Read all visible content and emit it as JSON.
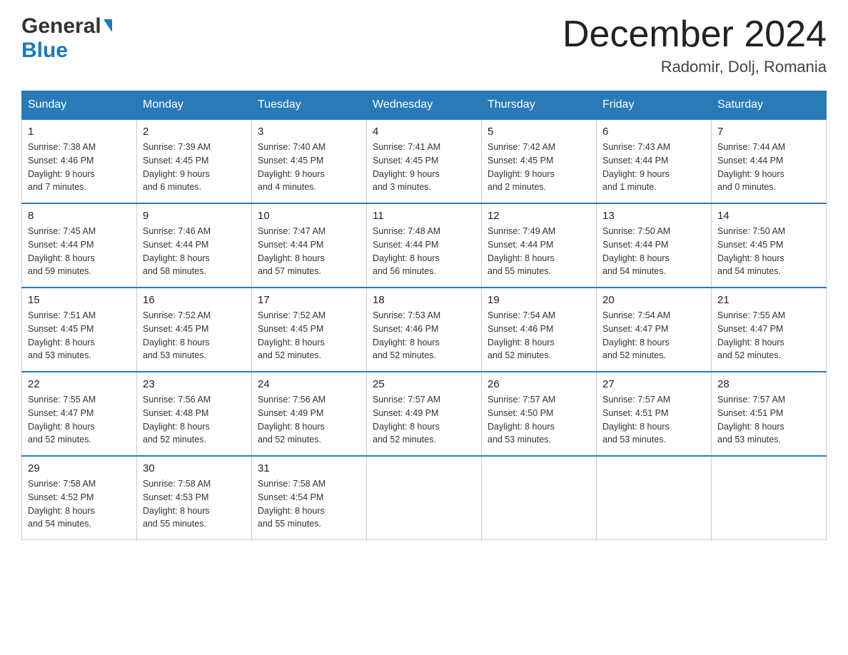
{
  "logo": {
    "general": "General",
    "blue": "Blue"
  },
  "title": "December 2024",
  "location": "Radomir, Dolj, Romania",
  "headers": [
    "Sunday",
    "Monday",
    "Tuesday",
    "Wednesday",
    "Thursday",
    "Friday",
    "Saturday"
  ],
  "weeks": [
    [
      {
        "day": "1",
        "sunrise": "7:38 AM",
        "sunset": "4:46 PM",
        "daylight": "9 hours and 7 minutes."
      },
      {
        "day": "2",
        "sunrise": "7:39 AM",
        "sunset": "4:45 PM",
        "daylight": "9 hours and 6 minutes."
      },
      {
        "day": "3",
        "sunrise": "7:40 AM",
        "sunset": "4:45 PM",
        "daylight": "9 hours and 4 minutes."
      },
      {
        "day": "4",
        "sunrise": "7:41 AM",
        "sunset": "4:45 PM",
        "daylight": "9 hours and 3 minutes."
      },
      {
        "day": "5",
        "sunrise": "7:42 AM",
        "sunset": "4:45 PM",
        "daylight": "9 hours and 2 minutes."
      },
      {
        "day": "6",
        "sunrise": "7:43 AM",
        "sunset": "4:44 PM",
        "daylight": "9 hours and 1 minute."
      },
      {
        "day": "7",
        "sunrise": "7:44 AM",
        "sunset": "4:44 PM",
        "daylight": "9 hours and 0 minutes."
      }
    ],
    [
      {
        "day": "8",
        "sunrise": "7:45 AM",
        "sunset": "4:44 PM",
        "daylight": "8 hours and 59 minutes."
      },
      {
        "day": "9",
        "sunrise": "7:46 AM",
        "sunset": "4:44 PM",
        "daylight": "8 hours and 58 minutes."
      },
      {
        "day": "10",
        "sunrise": "7:47 AM",
        "sunset": "4:44 PM",
        "daylight": "8 hours and 57 minutes."
      },
      {
        "day": "11",
        "sunrise": "7:48 AM",
        "sunset": "4:44 PM",
        "daylight": "8 hours and 56 minutes."
      },
      {
        "day": "12",
        "sunrise": "7:49 AM",
        "sunset": "4:44 PM",
        "daylight": "8 hours and 55 minutes."
      },
      {
        "day": "13",
        "sunrise": "7:50 AM",
        "sunset": "4:44 PM",
        "daylight": "8 hours and 54 minutes."
      },
      {
        "day": "14",
        "sunrise": "7:50 AM",
        "sunset": "4:45 PM",
        "daylight": "8 hours and 54 minutes."
      }
    ],
    [
      {
        "day": "15",
        "sunrise": "7:51 AM",
        "sunset": "4:45 PM",
        "daylight": "8 hours and 53 minutes."
      },
      {
        "day": "16",
        "sunrise": "7:52 AM",
        "sunset": "4:45 PM",
        "daylight": "8 hours and 53 minutes."
      },
      {
        "day": "17",
        "sunrise": "7:52 AM",
        "sunset": "4:45 PM",
        "daylight": "8 hours and 52 minutes."
      },
      {
        "day": "18",
        "sunrise": "7:53 AM",
        "sunset": "4:46 PM",
        "daylight": "8 hours and 52 minutes."
      },
      {
        "day": "19",
        "sunrise": "7:54 AM",
        "sunset": "4:46 PM",
        "daylight": "8 hours and 52 minutes."
      },
      {
        "day": "20",
        "sunrise": "7:54 AM",
        "sunset": "4:47 PM",
        "daylight": "8 hours and 52 minutes."
      },
      {
        "day": "21",
        "sunrise": "7:55 AM",
        "sunset": "4:47 PM",
        "daylight": "8 hours and 52 minutes."
      }
    ],
    [
      {
        "day": "22",
        "sunrise": "7:55 AM",
        "sunset": "4:47 PM",
        "daylight": "8 hours and 52 minutes."
      },
      {
        "day": "23",
        "sunrise": "7:56 AM",
        "sunset": "4:48 PM",
        "daylight": "8 hours and 52 minutes."
      },
      {
        "day": "24",
        "sunrise": "7:56 AM",
        "sunset": "4:49 PM",
        "daylight": "8 hours and 52 minutes."
      },
      {
        "day": "25",
        "sunrise": "7:57 AM",
        "sunset": "4:49 PM",
        "daylight": "8 hours and 52 minutes."
      },
      {
        "day": "26",
        "sunrise": "7:57 AM",
        "sunset": "4:50 PM",
        "daylight": "8 hours and 53 minutes."
      },
      {
        "day": "27",
        "sunrise": "7:57 AM",
        "sunset": "4:51 PM",
        "daylight": "8 hours and 53 minutes."
      },
      {
        "day": "28",
        "sunrise": "7:57 AM",
        "sunset": "4:51 PM",
        "daylight": "8 hours and 53 minutes."
      }
    ],
    [
      {
        "day": "29",
        "sunrise": "7:58 AM",
        "sunset": "4:52 PM",
        "daylight": "8 hours and 54 minutes."
      },
      {
        "day": "30",
        "sunrise": "7:58 AM",
        "sunset": "4:53 PM",
        "daylight": "8 hours and 55 minutes."
      },
      {
        "day": "31",
        "sunrise": "7:58 AM",
        "sunset": "4:54 PM",
        "daylight": "8 hours and 55 minutes."
      },
      null,
      null,
      null,
      null
    ]
  ],
  "labels": {
    "sunrise": "Sunrise:",
    "sunset": "Sunset:",
    "daylight": "Daylight:"
  }
}
